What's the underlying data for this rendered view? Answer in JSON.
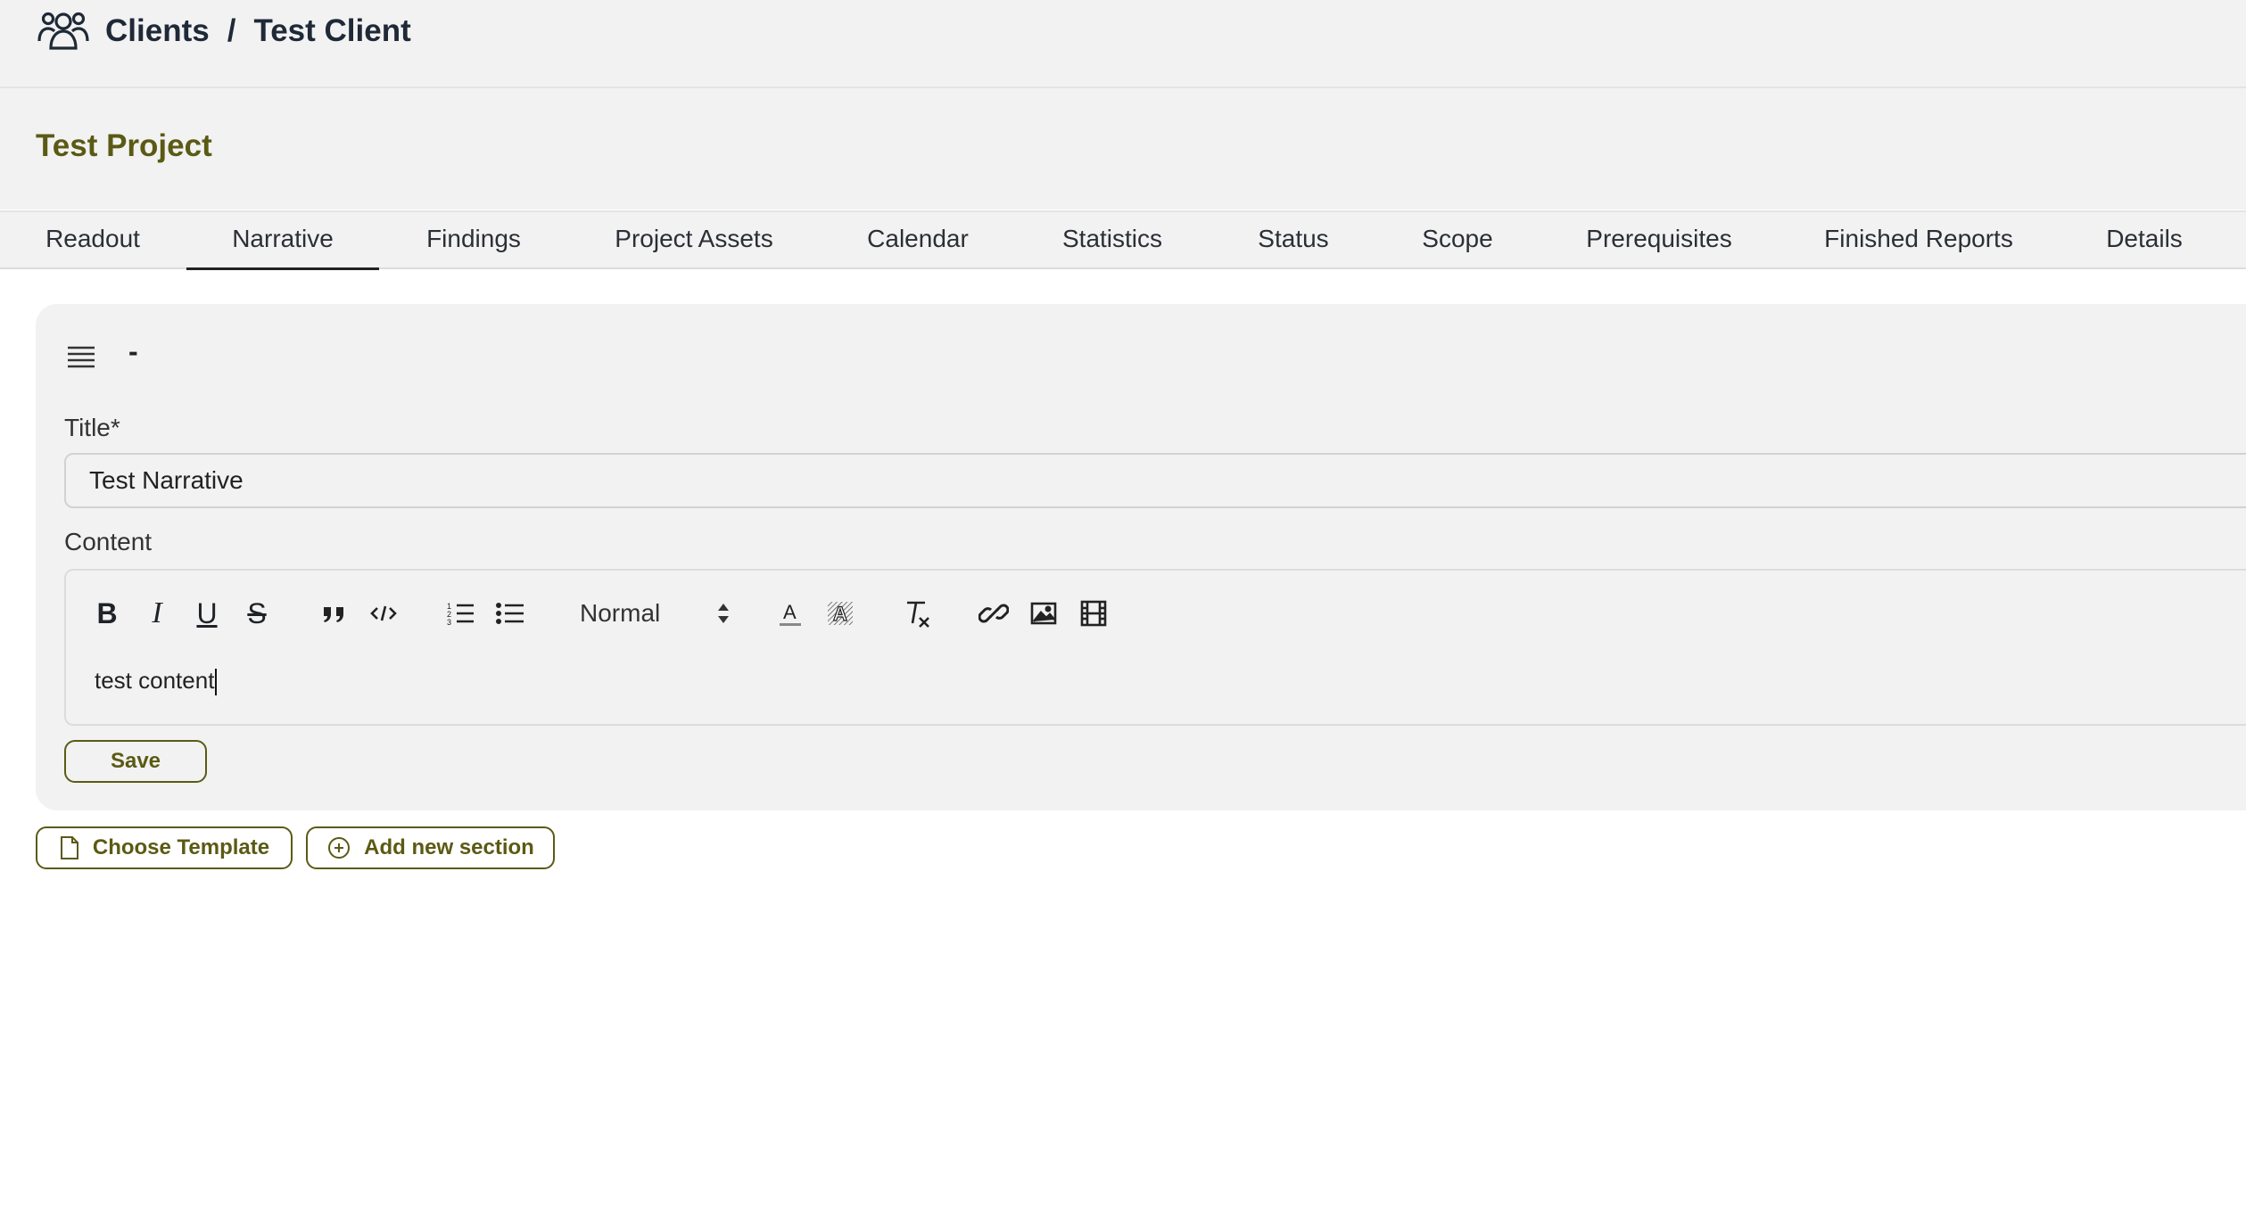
{
  "breadcrumb": {
    "root": "Clients",
    "separator": "/",
    "current": "Test Client",
    "icon": "users-icon"
  },
  "project": {
    "title": "Test Project"
  },
  "tabs": [
    {
      "label": "Readout",
      "active": false
    },
    {
      "label": "Narrative",
      "active": true
    },
    {
      "label": "Findings",
      "active": false
    },
    {
      "label": "Project Assets",
      "active": false
    },
    {
      "label": "Calendar",
      "active": false
    },
    {
      "label": "Statistics",
      "active": false
    },
    {
      "label": "Status",
      "active": false
    },
    {
      "label": "Scope",
      "active": false
    },
    {
      "label": "Prerequisites",
      "active": false
    },
    {
      "label": "Finished Reports",
      "active": false
    },
    {
      "label": "Details",
      "active": false
    }
  ],
  "section": {
    "menu_icon": "menu-icon",
    "collapse_label": "-",
    "title_label": "Title*",
    "title_value": "Test Narrative",
    "content_label": "Content",
    "toolbar": {
      "buttons": [
        "bold",
        "italic",
        "underline",
        "strikethrough",
        "blockquote",
        "code",
        "ordered-list",
        "bullet-list",
        "text-color",
        "background-color",
        "clear-format",
        "link",
        "image",
        "video"
      ],
      "bold_glyph": "B",
      "italic_glyph": "I",
      "underline_glyph": "U",
      "strike_glyph": "S",
      "heading_select": "Normal"
    },
    "content_text": "test content",
    "save_label": "Save"
  },
  "actions": {
    "choose_template": "Choose Template",
    "add_section": "Add new section"
  },
  "colors": {
    "accent": "#5b5a14",
    "panel": "#f2f2f2",
    "text": "#1f2328"
  }
}
